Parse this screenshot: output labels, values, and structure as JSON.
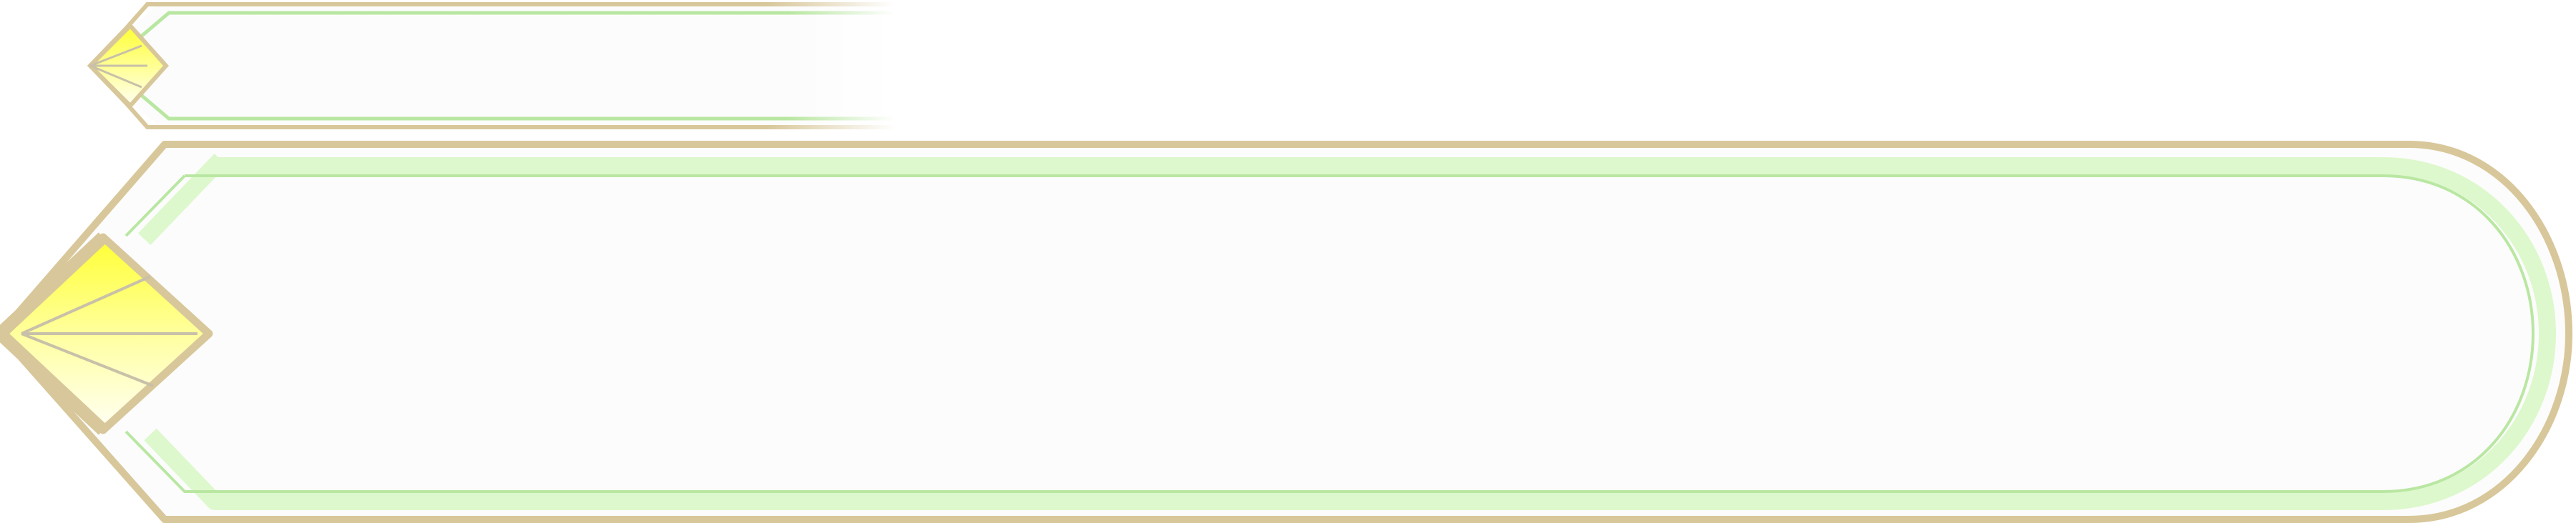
{
  "colors": {
    "frame_gold": "#D8C79A",
    "inner_green": "#DDF8CC",
    "inner_green_line": "#B9E7A2",
    "panel_fill": "#FCFCFC",
    "gem_yellow_top": "#FFFF33",
    "gem_yellow_bottom": "#FFFFF4",
    "gem_facet_line": "#C8C0A8"
  },
  "panels": [
    {
      "name": "small-header-panel",
      "text": ""
    },
    {
      "name": "large-main-panel",
      "text": ""
    }
  ]
}
